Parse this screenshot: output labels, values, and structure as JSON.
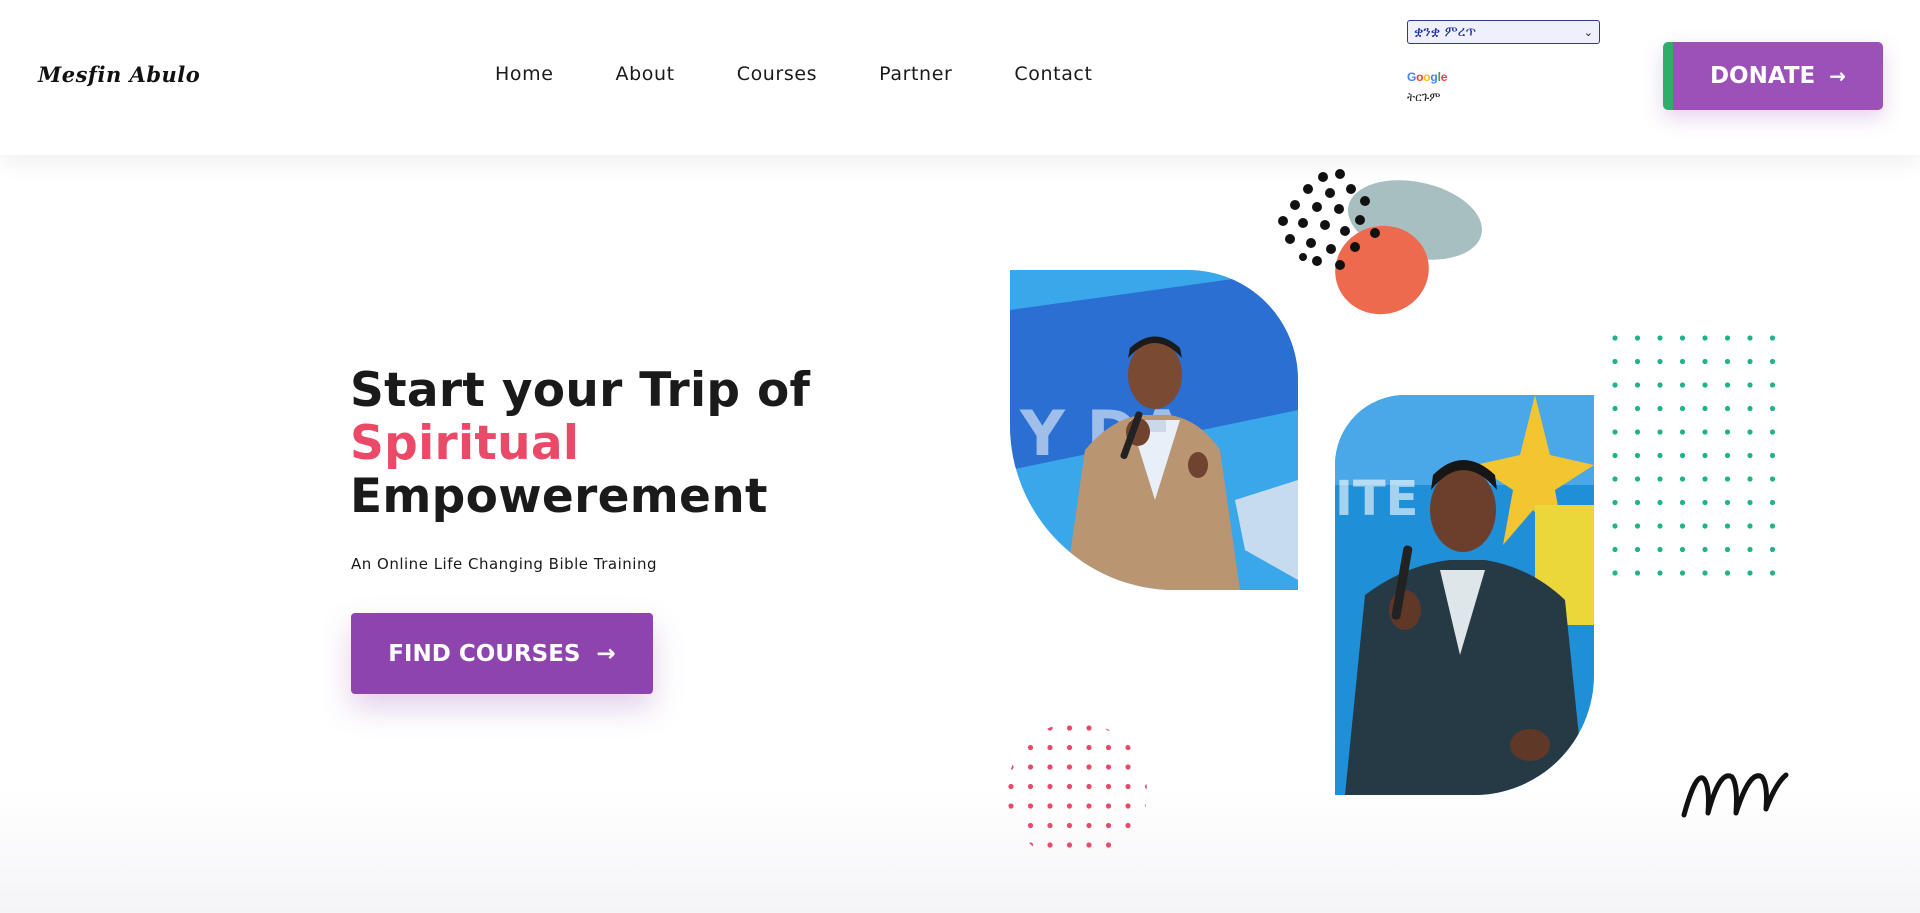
{
  "brand": {
    "logo_text": "Mesfin Abulo"
  },
  "nav": {
    "items": [
      {
        "label": "Home"
      },
      {
        "label": "About"
      },
      {
        "label": "Courses"
      },
      {
        "label": "Partner"
      },
      {
        "label": "Contact"
      }
    ]
  },
  "translate": {
    "selected_language": "ቋንቋ ምረጥ",
    "google_label": "ትርጉም"
  },
  "donate": {
    "label": "DONATE"
  },
  "hero": {
    "title_line1": "Start your Trip of",
    "title_accent": "Spiritual",
    "title_line3": "Empowerement",
    "subtitle": "An Online Life Changing Bible Training",
    "cta_label": "FIND COURSES"
  },
  "colors": {
    "primary_purple": "#8e44ad",
    "donate_purple": "#9b51b8",
    "donate_accent_green": "#2fae6b",
    "accent_pink": "#ea4a68",
    "dot_teal": "#1fb38a",
    "blob_coral": "#ee6a4f",
    "blob_gray": "#a7bfc1"
  },
  "icons": {
    "donate_arrow": "arrow-right-icon",
    "cta_arrow": "arrow-right-icon",
    "dropdown": "chevron-down-icon"
  }
}
